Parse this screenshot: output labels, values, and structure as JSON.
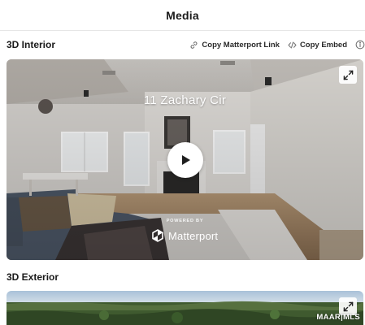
{
  "header": {
    "title": "Media"
  },
  "interior": {
    "heading": "3D Interior",
    "copy_link_label": "Copy Matterport Link",
    "copy_embed_label": "Copy Embed",
    "address": "11 Zachary Cir",
    "powered_by": "POWERED BY",
    "brand": "Matterport"
  },
  "exterior": {
    "heading": "3D Exterior",
    "watermark": "MAAR|MLS"
  },
  "icons": {
    "link": "link-icon",
    "embed": "code-icon",
    "info": "info-icon",
    "expand": "expand-icon",
    "play": "play-icon",
    "matterport": "matterport-logo-icon"
  }
}
